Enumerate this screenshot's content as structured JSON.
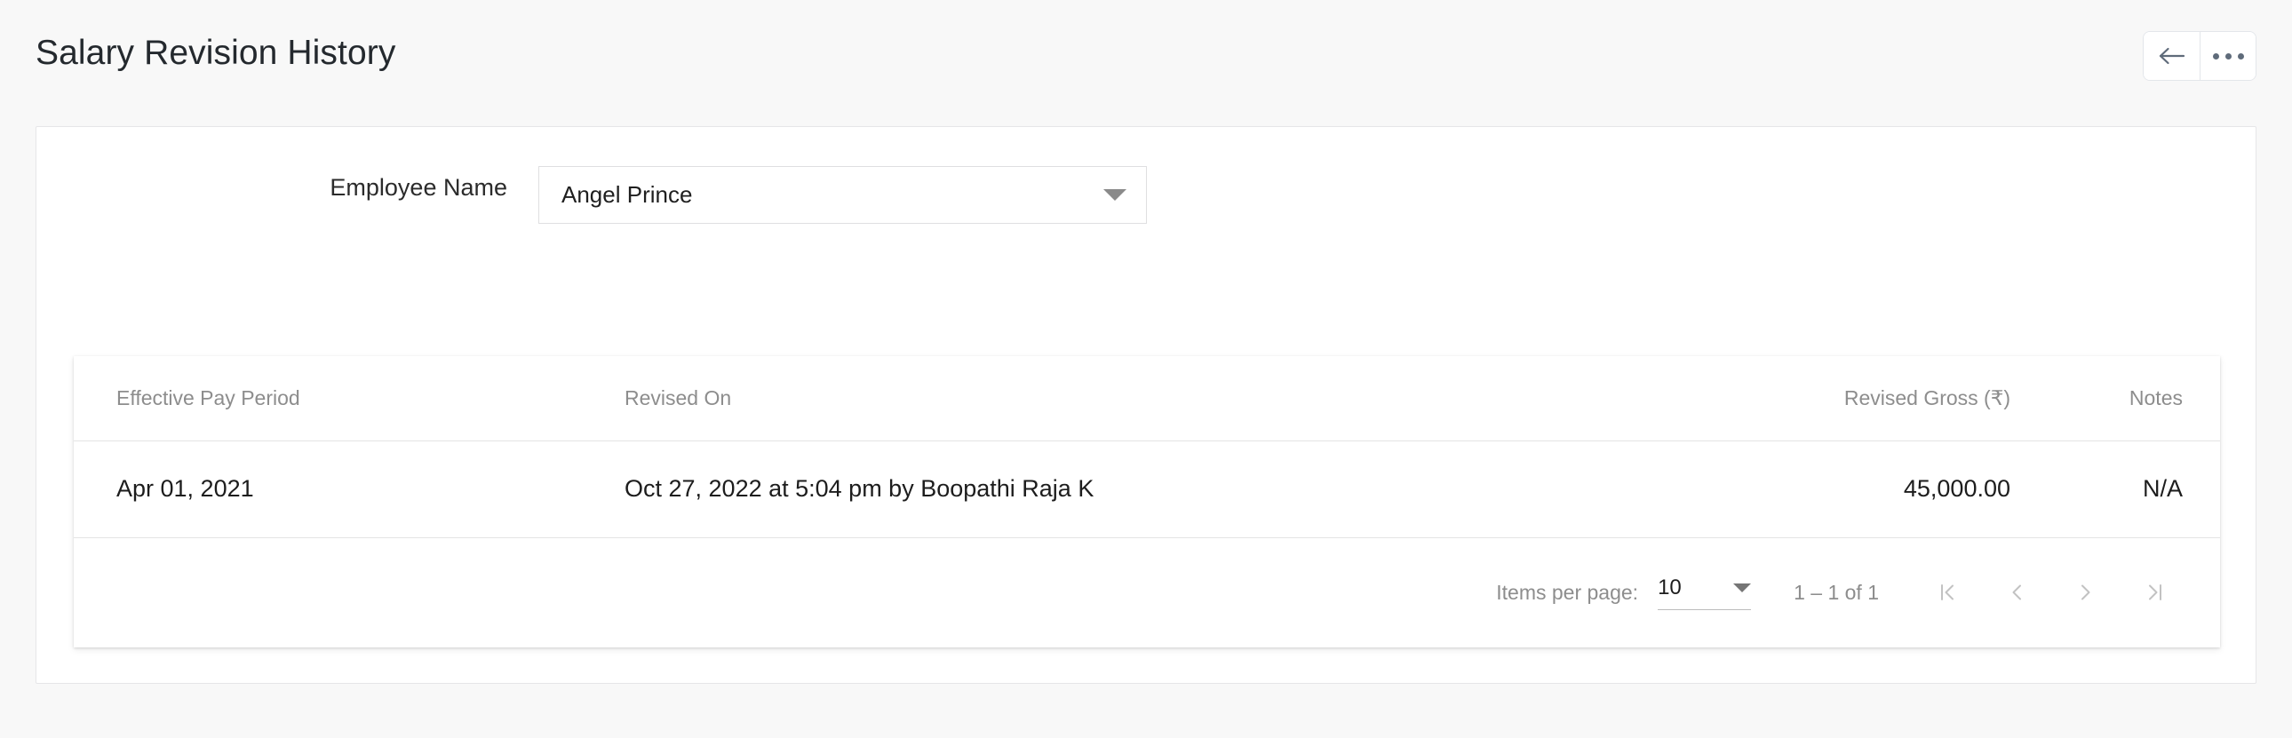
{
  "header": {
    "title": "Salary Revision History",
    "actions": [
      {
        "name": "back-button",
        "icon": "arrow-left-icon"
      },
      {
        "name": "more-options-button",
        "icon": "ellipsis-icon"
      }
    ]
  },
  "filter": {
    "label": "Employee Name",
    "employee_select": {
      "value": "Angel Prince",
      "icon": "chevron-down-icon"
    }
  },
  "table": {
    "columns": [
      "Effective Pay Period",
      "Revised On",
      "Revised Gross (₹)",
      "Notes"
    ],
    "rows": [
      {
        "effective_pay_period": "Apr 01, 2021",
        "revised_on": "Oct 27, 2022 at 5:04 pm by Boopathi Raja K",
        "revised_gross": "45,000.00",
        "notes": "N/A"
      }
    ]
  },
  "paginator": {
    "items_per_page_label": "Items per page:",
    "items_per_page_value": "10",
    "range_label": "1 – 1 of 1",
    "buttons": [
      {
        "name": "first-page-button",
        "icon": "first-page-icon"
      },
      {
        "name": "previous-page-button",
        "icon": "chevron-left-icon"
      },
      {
        "name": "next-page-button",
        "icon": "chevron-right-icon"
      },
      {
        "name": "last-page-button",
        "icon": "last-page-icon"
      }
    ]
  },
  "colors": {
    "page_background": "#f8f8f8",
    "card_background": "#ffffff",
    "text_primary": "#1d1d1d",
    "text_muted": "#8d8d8d",
    "icon_slate": "#5f6b7a",
    "divider": "#e4e4e4"
  }
}
